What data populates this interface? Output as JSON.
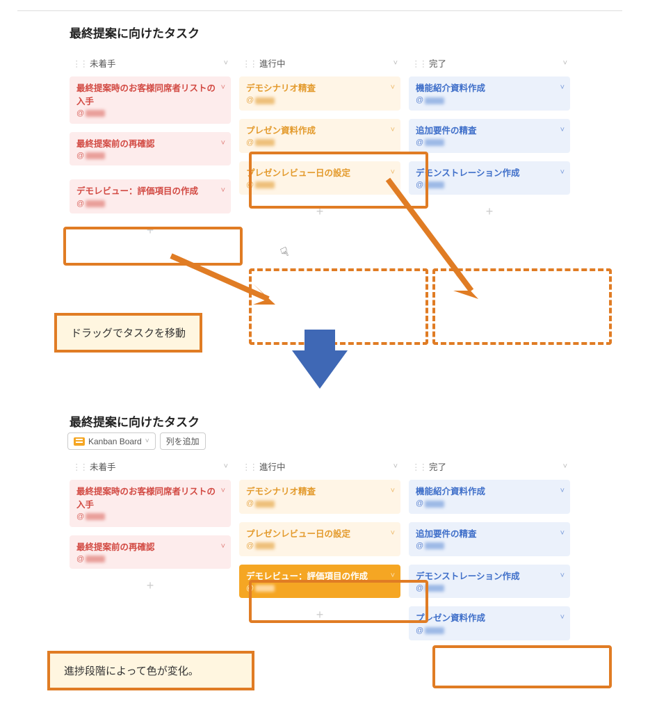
{
  "colors": {
    "highlight": "#e07c24",
    "arrow_blue": "#3f68b5",
    "annot_bg": "#fff6e0"
  },
  "top": {
    "title": "最終提案に向けたタスク",
    "columns": [
      {
        "id": "todo",
        "label": "未着手",
        "cards": [
          {
            "id": "t1",
            "title": "最終提案時のお客様同席者リストの入手",
            "theme": "red"
          },
          {
            "id": "t2",
            "title": "最終提案前の再確認",
            "theme": "red"
          },
          {
            "id": "t3",
            "title": "デモレビュー：評価項目の作成",
            "theme": "red",
            "highlighted": true
          }
        ]
      },
      {
        "id": "doing",
        "label": "進行中",
        "cards": [
          {
            "id": "d1",
            "title": "デモシナリオ精査",
            "theme": "org"
          },
          {
            "id": "d2",
            "title": "プレゼン資料作成",
            "theme": "org",
            "highlighted": true
          },
          {
            "id": "d3",
            "title": "プレゼンレビュー日の設定",
            "theme": "org"
          }
        ]
      },
      {
        "id": "done",
        "label": "完了",
        "cards": [
          {
            "id": "c1",
            "title": "機能紹介資料作成",
            "theme": "blue"
          },
          {
            "id": "c2",
            "title": "追加要件の精査",
            "theme": "blue"
          },
          {
            "id": "c3",
            "title": "デモンストレーション作成",
            "theme": "blue"
          }
        ]
      }
    ]
  },
  "bottom": {
    "title": "最終提案に向けたタスク",
    "toolbar": {
      "kanban": "Kanban Board",
      "addcol": "列を追加"
    },
    "columns": [
      {
        "id": "todo",
        "label": "未着手",
        "cards": [
          {
            "id": "bt1",
            "title": "最終提案時のお客様同席者リストの入手",
            "theme": "red"
          },
          {
            "id": "bt2",
            "title": "最終提案前の再確認",
            "theme": "red"
          }
        ]
      },
      {
        "id": "doing",
        "label": "進行中",
        "cards": [
          {
            "id": "bd1",
            "title": "デモシナリオ精査",
            "theme": "org"
          },
          {
            "id": "bd2",
            "title": "プレゼンレビュー日の設定",
            "theme": "org"
          },
          {
            "id": "bd3",
            "title": "デモレビュー：評価項目の作成",
            "theme": "org-solid",
            "highlighted": true
          }
        ]
      },
      {
        "id": "done",
        "label": "完了",
        "cards": [
          {
            "id": "bc1",
            "title": "機能紹介資料作成",
            "theme": "blue"
          },
          {
            "id": "bc2",
            "title": "追加要件の精査",
            "theme": "blue"
          },
          {
            "id": "bc3",
            "title": "デモンストレーション作成",
            "theme": "blue"
          },
          {
            "id": "bc4",
            "title": "プレゼン資料作成",
            "theme": "blue",
            "highlighted": true
          }
        ]
      }
    ]
  },
  "annots": {
    "drag": "ドラッグでタスクを移動",
    "color": "進捗段階によって色が変化。"
  },
  "glyphs": {
    "plus": "+",
    "chev_down": "˅",
    "grip": "⋮⋮"
  }
}
